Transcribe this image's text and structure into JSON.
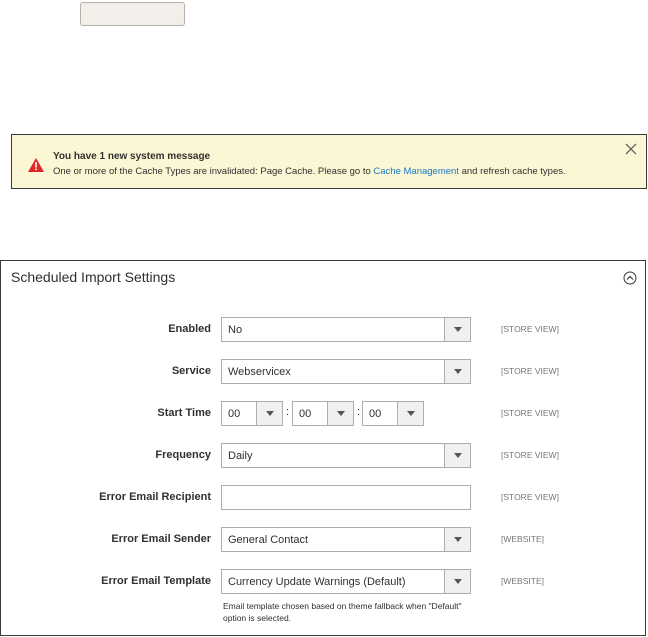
{
  "notification": {
    "title": "You have 1 new system message",
    "text_before": "One or more of the Cache Types are invalidated: Page Cache. Please go to ",
    "link": "Cache Management",
    "text_after": " and refresh cache types."
  },
  "panel": {
    "title": "Scheduled Import Settings",
    "fields": {
      "enabled": {
        "label": "Enabled",
        "value": "No",
        "scope": "[STORE VIEW]"
      },
      "service": {
        "label": "Service",
        "value": "Webservicex",
        "scope": "[STORE VIEW]"
      },
      "start_time": {
        "label": "Start Time",
        "hour": "00",
        "minute": "00",
        "second": "00",
        "separator": ":",
        "scope": "[STORE VIEW]"
      },
      "frequency": {
        "label": "Frequency",
        "value": "Daily",
        "scope": "[STORE VIEW]"
      },
      "error_recipient": {
        "label": "Error Email Recipient",
        "value": "",
        "scope": "[STORE VIEW]"
      },
      "error_sender": {
        "label": "Error Email Sender",
        "value": "General Contact",
        "scope": "[WEBSITE]"
      },
      "error_template": {
        "label": "Error Email Template",
        "value": "Currency Update Warnings (Default)",
        "scope": "[WEBSITE]",
        "note": "Email template chosen based on theme fallback when \"Default\" option is selected."
      }
    }
  },
  "colors": {
    "accent_link": "#1979c3",
    "warning": "#e22626",
    "message_bg": "#fbf6d3"
  },
  "icons": [
    "warning-icon",
    "close-icon",
    "collapse-icon",
    "chevron-down-icon"
  ]
}
